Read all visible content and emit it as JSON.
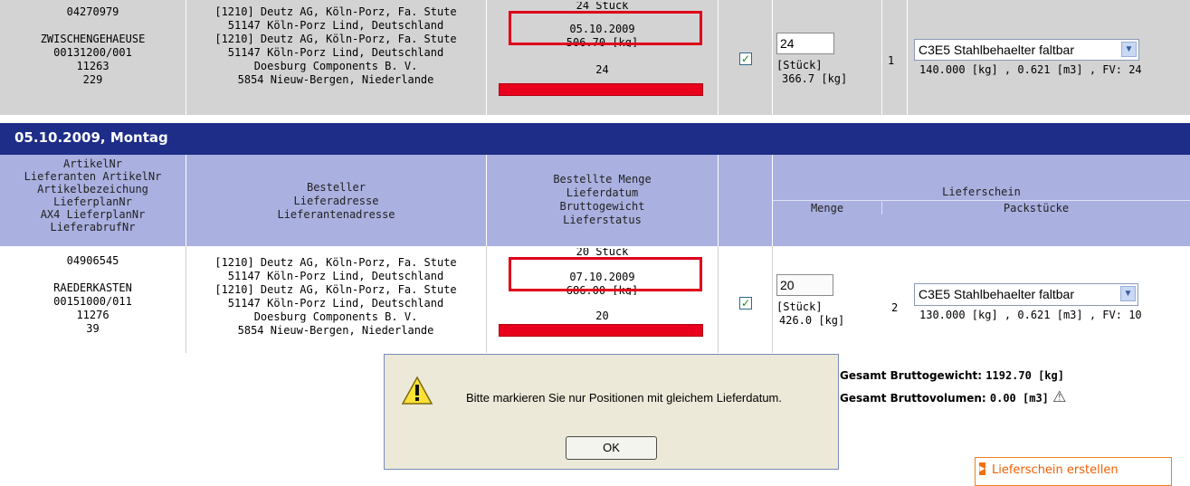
{
  "row1": {
    "artikel_lines": [
      "04270979",
      "",
      "ZWISCHENGEHAEUSE",
      "00131200/001",
      "11263",
      "229"
    ],
    "address_lines": [
      "[1210] Deutz AG,  Köln-Porz, Fa. Stute",
      "51147 Köln-Porz Lind,  Deutschland",
      "[1210] Deutz AG,  Köln-Porz, Fa. Stute",
      "51147 Köln-Porz Lind,  Deutschland",
      "Doesburg Components B. V.",
      "5854 Nieuw-Bergen,  Niederlande"
    ],
    "menge_stueck": "24 Stück",
    "lieferdatum": "05.10.2009",
    "gewicht": "506.70 [kg]",
    "status_value": "24",
    "qty_input": "24",
    "unit": "[Stück]",
    "weight": "366.7 [kg]",
    "pack_count": "1",
    "pack_select": "C3E5 Stahlbehaelter faltbar",
    "pack_info": "140.000 [kg] ,  0.621 [m3] , FV: 24",
    "checked": true
  },
  "date_band": "05.10.2009, Montag",
  "headers": {
    "col1": [
      "ArtikelNr",
      "Lieferanten ArtikelNr",
      "Artikelbezeichung",
      "LieferplanNr",
      "AX4 LieferplanNr",
      "LieferabrufNr"
    ],
    "col2": [
      "Besteller",
      "Lieferadresse",
      "Lieferantenadresse"
    ],
    "col3": [
      "Bestellte Menge",
      "Lieferdatum",
      "Bruttogewicht",
      "Lieferstatus"
    ],
    "lieferschein": "Lieferschein",
    "menge": "Menge",
    "packstuecke": "Packstücke"
  },
  "row2": {
    "artikel_lines": [
      "04906545",
      "",
      "RAEDERKASTEN",
      "00151000/011",
      "11276",
      "39"
    ],
    "address_lines": [
      "[1210] Deutz AG,  Köln-Porz, Fa. Stute",
      "51147 Köln-Porz Lind,  Deutschland",
      "[1210] Deutz AG,  Köln-Porz, Fa. Stute",
      "51147 Köln-Porz Lind,  Deutschland",
      "Doesburg Components B. V.",
      "5854 Nieuw-Bergen,  Niederlande"
    ],
    "menge_stueck": "20 Stück",
    "lieferdatum": "07.10.2009",
    "gewicht": "686.00 [kg]",
    "status_value": "20",
    "qty_input": "20",
    "unit": "[Stück]",
    "weight": "426.0 [kg]",
    "pack_count": "2",
    "pack_select": "C3E5 Stahlbehaelter faltbar",
    "pack_info": "130.000 [kg] ,  0.621 [m3] , FV: 10",
    "checked": true
  },
  "totals": {
    "brutto_label": "Gesamt Bruttogewicht:",
    "brutto_value": "1192.70 [kg]",
    "volumen_label": "Gesamt Bruttovolumen:",
    "volumen_value": "0.00 [m3]"
  },
  "dialog": {
    "message": "Bitte markieren Sie nur Positionen mit gleichem Lieferdatum.",
    "ok_label": "OK"
  },
  "create_button": "Lieferschein erstellen",
  "colors": {
    "date_band": "#1d2d88",
    "header_bg": "#aab0e0",
    "row_bg": "#d3d3d3",
    "red": "#e8001c",
    "orange": "#f06000"
  }
}
